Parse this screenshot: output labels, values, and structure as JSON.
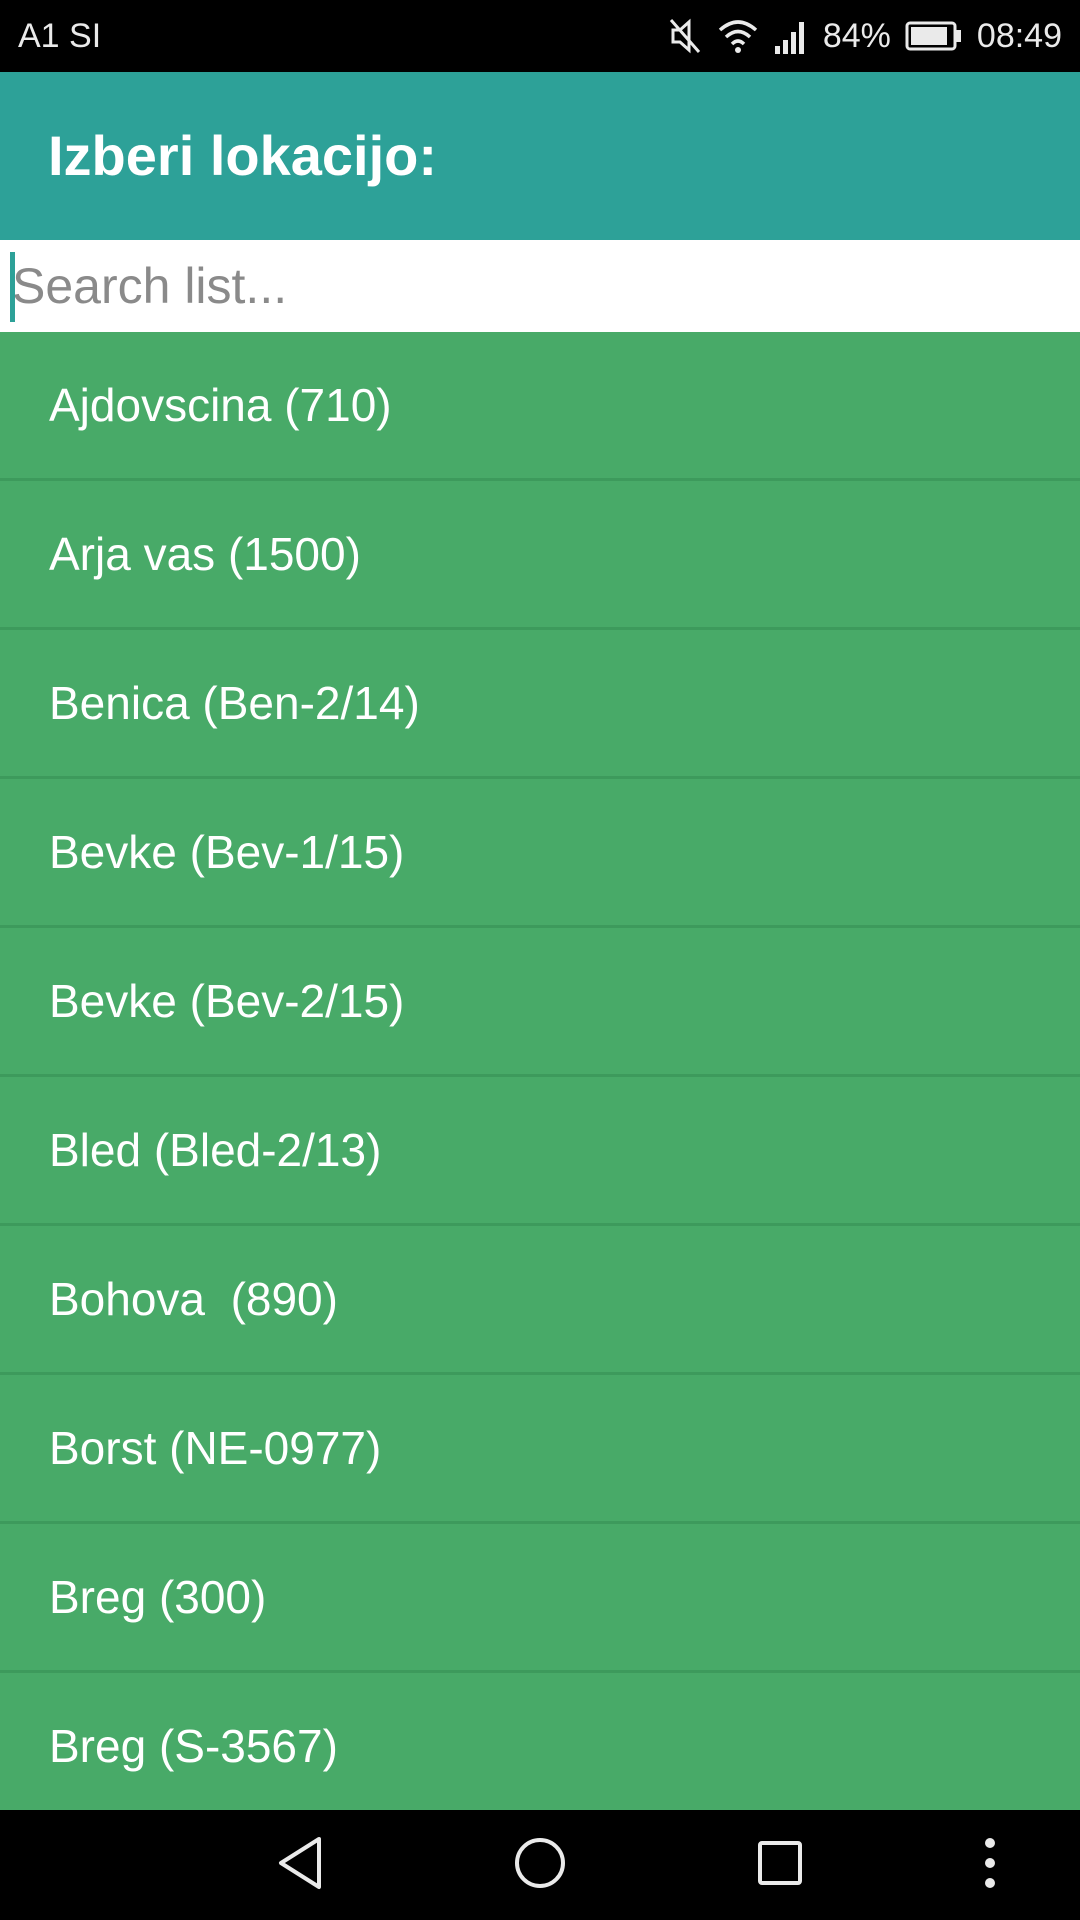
{
  "status_bar": {
    "carrier": "A1 SI",
    "battery_percent": "84%",
    "time": "08:49",
    "icons": [
      "mute-icon",
      "wifi-icon",
      "signal-icon",
      "battery-icon"
    ]
  },
  "header": {
    "title": "Izberi lokacijo:"
  },
  "search": {
    "placeholder": "Search list...",
    "value": ""
  },
  "list": {
    "items": [
      {
        "label": "Ajdovscina (710)"
      },
      {
        "label": "Arja vas (1500)"
      },
      {
        "label": "Benica (Ben-2/14)"
      },
      {
        "label": "Bevke (Bev-1/15)"
      },
      {
        "label": "Bevke (Bev-2/15)"
      },
      {
        "label": "Bled (Bled-2/13)"
      },
      {
        "label": "Bohova  (890)"
      },
      {
        "label": "Borst (NE-0977)"
      },
      {
        "label": "Breg (300)"
      },
      {
        "label": "Breg (S-3567)"
      }
    ]
  },
  "nav_bar": {
    "icons": [
      "back-icon",
      "home-icon",
      "recents-icon",
      "more-icon"
    ]
  },
  "colors": {
    "app_bar": "#2da198",
    "list_background": "#48aa68",
    "list_divider": "#3d9a5c",
    "search_background": "#ffffff"
  }
}
